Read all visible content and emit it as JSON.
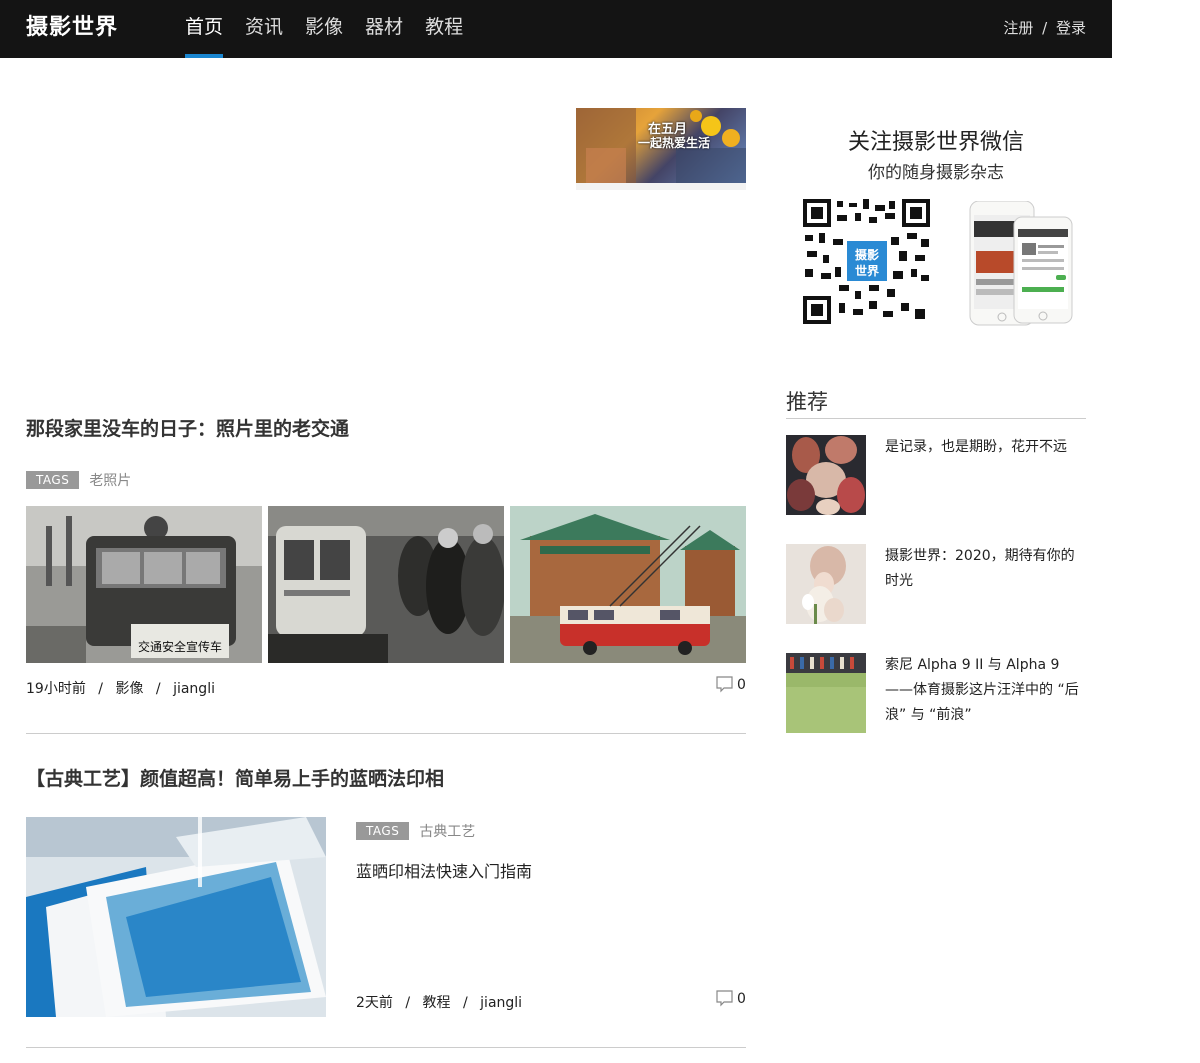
{
  "header": {
    "logo": "摄影世界",
    "nav": [
      {
        "label": "首页",
        "active": true
      },
      {
        "label": "资讯"
      },
      {
        "label": "影像"
      },
      {
        "label": "器材"
      },
      {
        "label": "教程"
      }
    ],
    "register": "注册",
    "separator": "/",
    "login": "登录"
  },
  "ad": {
    "line1": "在五月",
    "line2": "一起热爱生活"
  },
  "wechat": {
    "title": "关注摄影世界微信",
    "subtitle": "你的随身摄影杂志",
    "qr_label": "摄影世界"
  },
  "articles": [
    {
      "title": "那段家里没车的日子：照片里的老交通",
      "tags_label": "TAGS",
      "tag": "老照片",
      "time": "19小时前",
      "category": "影像",
      "author": "jiangli",
      "comments": "0",
      "sign_text": "交通安全宣传车"
    },
    {
      "title": "【古典工艺】颜值超高！简单易上手的蓝晒法印相",
      "tags_label": "TAGS",
      "tag": "古典工艺",
      "excerpt": "蓝晒印相法快速入门指南",
      "time": "2天前",
      "category": "教程",
      "author": "jiangli",
      "comments": "0"
    }
  ],
  "recommend": {
    "title": "推荐",
    "items": [
      {
        "text": "是记录，也是期盼，花开不远"
      },
      {
        "text": "摄影世界：2020，期待有你的时光"
      },
      {
        "text": "索尼 Alpha 9 II 与 Alpha 9 ——体育摄影这片汪洋中的 “后浪” 与 “前浪”"
      }
    ]
  },
  "meta_separator": "/",
  "colors": {
    "header_bg": "#141414",
    "nav_active_underline": "#1a86d0",
    "tag_badge": "#999999"
  }
}
